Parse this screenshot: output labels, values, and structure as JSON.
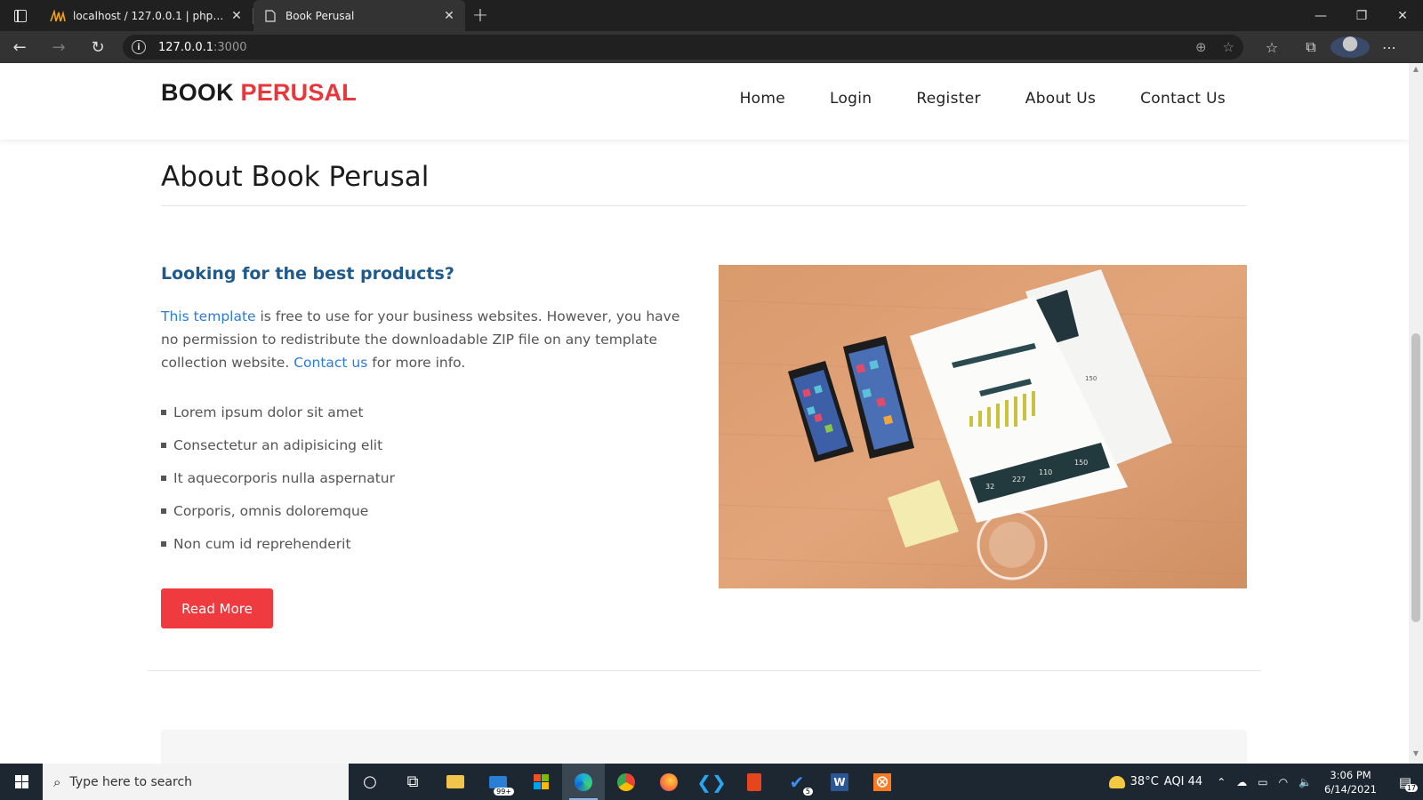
{
  "browser": {
    "tabs": [
      {
        "title": "localhost / 127.0.0.1 | phpMyAdmin",
        "active": false
      },
      {
        "title": "Book Perusal",
        "active": true
      }
    ],
    "new_tab_symbol": "+",
    "url_host": "127.0.0.1",
    "url_port": ":3000"
  },
  "site": {
    "brand_part1": "BOOK",
    "brand_part2": "PERUSAL",
    "nav": [
      "Home",
      "Login",
      "Register",
      "About Us",
      "Contact Us"
    ],
    "page_title": "About Book Perusal",
    "subheading": "Looking for the best products?",
    "intro": {
      "link1": "This template",
      "text1": " is free to use for your business websites. However, you have no permission to redistribute the downloadable ZIP file on any template collection website. ",
      "link2": "Contact us",
      "text2": " for more info."
    },
    "features": [
      "Lorem ipsum dolor sit amet",
      "Consectetur an adipisicing elit",
      "It aquecorporis nulla aspernatur",
      "Corporis, omnis doloremque",
      "Non cum id reprehenderit"
    ],
    "cta_label": "Read More",
    "image_labels": [
      "150",
      "110",
      "227",
      "32",
      "150"
    ]
  },
  "taskbar": {
    "search_placeholder": "Type here to search",
    "mail_badge": "99+",
    "todo_badge": "5",
    "temperature": "38°C",
    "aqi": "AQI 44",
    "time": "3:06 PM",
    "date": "6/14/2021",
    "notifications": "17"
  },
  "colors": {
    "brand_red": "#e8363b",
    "heading_blue": "#1e5a8e",
    "link_blue": "#2d7bd6",
    "button_red": "#ef3b3f"
  }
}
